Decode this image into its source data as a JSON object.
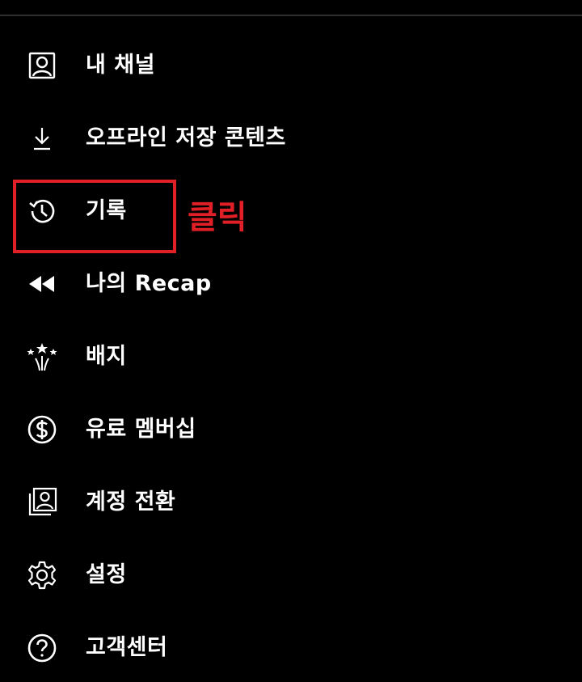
{
  "menu": {
    "items": [
      {
        "label": "내 채널",
        "icon": "account-box-icon"
      },
      {
        "label": "오프라인 저장 콘텐츠",
        "icon": "download-icon"
      },
      {
        "label": "기록",
        "icon": "history-icon"
      },
      {
        "label": "나의 Recap",
        "icon": "rewind-icon"
      },
      {
        "label": "배지",
        "icon": "fireworks-badge-icon"
      },
      {
        "label": "유료 멤버십",
        "icon": "dollar-circle-icon"
      },
      {
        "label": "계정 전환",
        "icon": "switch-account-icon"
      },
      {
        "label": "설정",
        "icon": "gear-icon"
      },
      {
        "label": "고객센터",
        "icon": "help-circle-icon"
      }
    ]
  },
  "annotation": {
    "text": "클릭",
    "color": "#e01f26",
    "highlighted_item": "기록"
  },
  "colors": {
    "background": "#000000",
    "text": "#ffffff",
    "divider": "#2e2e2e",
    "highlight": "#e01f26"
  }
}
